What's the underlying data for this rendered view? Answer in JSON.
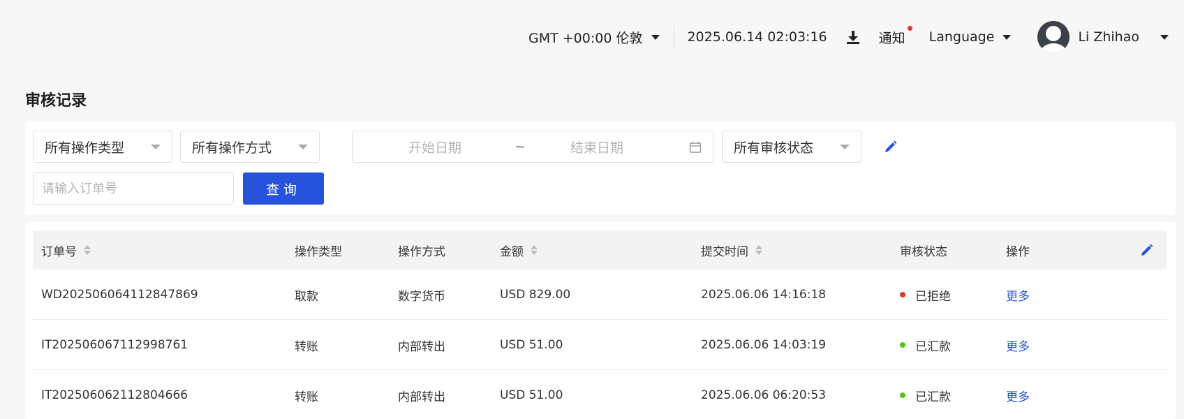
{
  "header": {
    "timezone": "GMT +00:00 伦敦",
    "datetime": "2025.06.14 02:03:16",
    "notify_label": "通知",
    "language_label": "Language",
    "user_name": "Li Zhihao"
  },
  "page": {
    "title": "审核记录"
  },
  "filters": {
    "operation_type": "所有操作类型",
    "operation_method": "所有操作方式",
    "start_date_placeholder": "开始日期",
    "date_separator": "~",
    "end_date_placeholder": "结束日期",
    "audit_status": "所有审核状态",
    "order_placeholder": "请输入订单号",
    "query_label": "查询"
  },
  "table": {
    "columns": {
      "order_no": "订单号",
      "type": "操作类型",
      "method": "操作方式",
      "amount": "金额",
      "time": "提交时间",
      "status": "审核状态",
      "action": "操作"
    },
    "rows": [
      {
        "order_no": "WD202506064112847869",
        "type": "取款",
        "method": "数字货币",
        "amount": "USD 829.00",
        "time": "2025.06.06 14:16:18",
        "status": "已拒绝",
        "status_color": "#e8312f",
        "action": "更多"
      },
      {
        "order_no": "IT202506067112998761",
        "type": "转账",
        "method": "内部转出",
        "amount": "USD 51.00",
        "time": "2025.06.06 14:03:19",
        "status": "已汇款",
        "status_color": "#52c41a",
        "action": "更多"
      },
      {
        "order_no": "IT202506062112804666",
        "type": "转账",
        "method": "内部转出",
        "amount": "USD 51.00",
        "time": "2025.06.06 06:20:53",
        "status": "已汇款",
        "status_color": "#52c41a",
        "action": "更多"
      }
    ]
  },
  "colors": {
    "primary": "#2653d9",
    "rejected": "#e8312f",
    "remitted": "#52c41a",
    "notify_dot": "#e8312f"
  }
}
